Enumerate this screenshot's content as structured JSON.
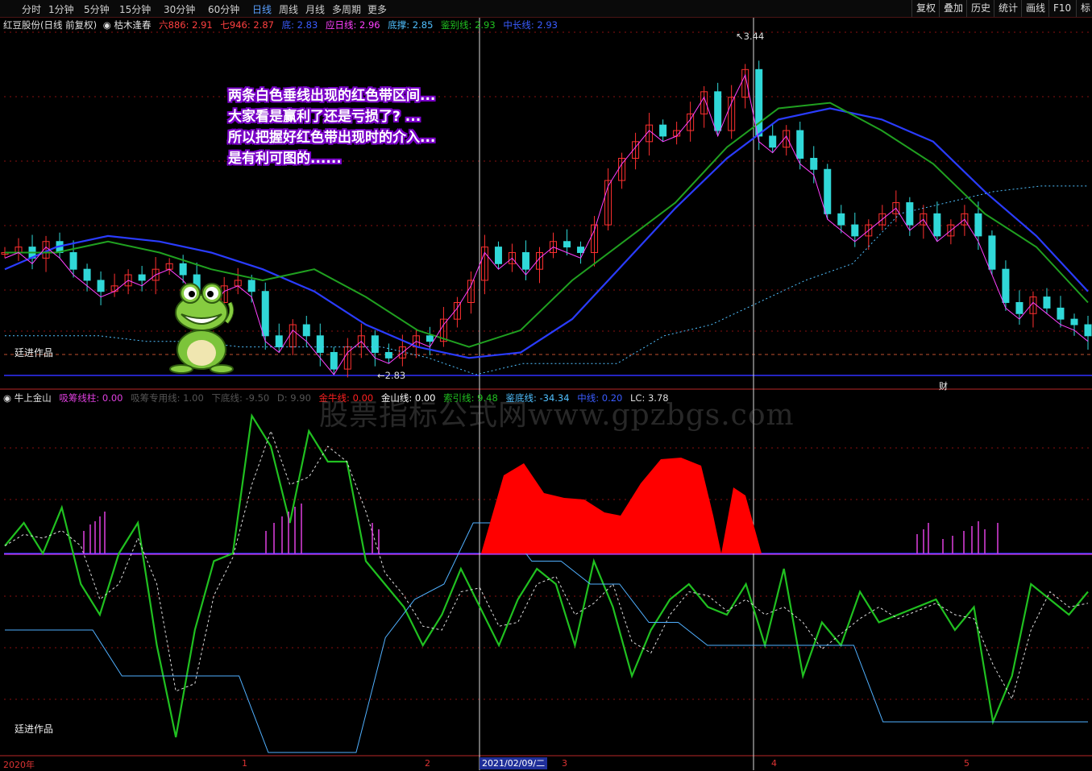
{
  "toolbar": {
    "periods": [
      "分时",
      "1分钟",
      "5分钟",
      "15分钟",
      "30分钟",
      "60分钟",
      "日线",
      "周线",
      "月线",
      "多周期",
      "更多"
    ],
    "active": "日线",
    "right": [
      "复权",
      "叠加",
      "历史",
      "统计",
      "画线",
      "F10",
      "标"
    ]
  },
  "main_panel": {
    "stock": "红豆股份(日线 前复权)",
    "indicator": "枯木逢春",
    "lines": [
      {
        "label": "六886: 2.91",
        "color": "#ff4040"
      },
      {
        "label": "七946: 2.87",
        "color": "#ff4040"
      },
      {
        "label": "底: 2.83",
        "color": "#3a5cff"
      },
      {
        "label": "应日线: 2.96",
        "color": "#ff40ff"
      },
      {
        "label": "底撑: 2.85",
        "color": "#50c0ff"
      },
      {
        "label": "鉴别线: 2.93",
        "color": "#20c020"
      },
      {
        "label": "中长线: 2.93",
        "color": "#3a5cff"
      }
    ],
    "high_label": "3.44",
    "low_label": "2.83",
    "annotation": [
      "两条白色垂线出现的红色带区间...",
      "大家看是赢利了还是亏损了? ...",
      "所以把握好红色带出现时的介入...",
      "是有利可图的......"
    ],
    "signature": "廷进作品",
    "cai": "财"
  },
  "sub_panel": {
    "indicator": "牛上金山",
    "lines": [
      {
        "label": "吸筹线柱: 0.00",
        "color": "#e040e0"
      },
      {
        "label": "吸筹专用线: 1.00",
        "color": "#555555"
      },
      {
        "label": "下底线: -9.50",
        "color": "#555555"
      },
      {
        "label": "D: 9.90",
        "color": "#555555"
      },
      {
        "label": "金牛线: 0.00",
        "color": "#ff2020"
      },
      {
        "label": "金山线: 0.00",
        "color": "#ffffff"
      },
      {
        "label": "索引线: 9.48",
        "color": "#20c020"
      },
      {
        "label": "鉴底线: -34.34",
        "color": "#50c0ff"
      },
      {
        "label": "中线: 0.20",
        "color": "#3a5cff"
      },
      {
        "label": "LC: 3.78",
        "color": "#dddddd"
      }
    ],
    "signature": "廷进作品",
    "watermark": "股票指标公式网www.gpzbgs.com"
  },
  "x_axis": {
    "labels": [
      "2020年",
      "1",
      "2",
      "3",
      "4",
      "5"
    ],
    "cursor_date": "2021/02/09/二"
  },
  "chart_data": {
    "type": "line",
    "title": "红豆股份(日线 前复权)",
    "price_range": [
      2.83,
      3.44
    ],
    "vertical_markers": 2,
    "month_ticks": [
      "2020年",
      "1",
      "2",
      "3",
      "4",
      "5"
    ],
    "main_series": [
      {
        "name": "中长线",
        "values": [
          3.02,
          3.06,
          3.08,
          3.07,
          3.05,
          3.02,
          2.98,
          2.92,
          2.88,
          2.86,
          2.87,
          2.93,
          3.03,
          3.13,
          3.22,
          3.29,
          3.31,
          3.29,
          3.25,
          3.16,
          3.08,
          2.98
        ]
      },
      {
        "name": "鉴别线",
        "values": [
          3.05,
          3.05,
          3.07,
          3.05,
          3.02,
          3.0,
          3.02,
          2.97,
          2.91,
          2.88,
          2.91,
          3.0,
          3.07,
          3.14,
          3.24,
          3.31,
          3.32,
          3.27,
          3.21,
          3.12,
          3.06,
          2.96
        ]
      }
    ],
    "sub_series": [
      {
        "name": "索引线",
        "values": [
          5,
          20,
          0,
          30,
          -20,
          -40,
          0,
          20,
          -60,
          -120,
          -50,
          -5,
          0,
          90,
          70,
          20,
          80,
          60,
          60,
          -5,
          -20,
          -35,
          -60,
          -40,
          -10,
          -35,
          -60,
          -30,
          -10,
          -20,
          -60,
          -5,
          -35,
          -80,
          -50,
          -30,
          -20,
          -35,
          -40,
          -20,
          -60,
          -10,
          -80,
          -45,
          -60,
          -25,
          -45,
          -40,
          -35,
          -30,
          -50,
          -35,
          -110,
          -80,
          -20,
          -30,
          -40,
          -25
        ]
      }
    ],
    "red_band": {
      "start_label": "2021/02/09/二",
      "description": "金牛线 area"
    }
  }
}
